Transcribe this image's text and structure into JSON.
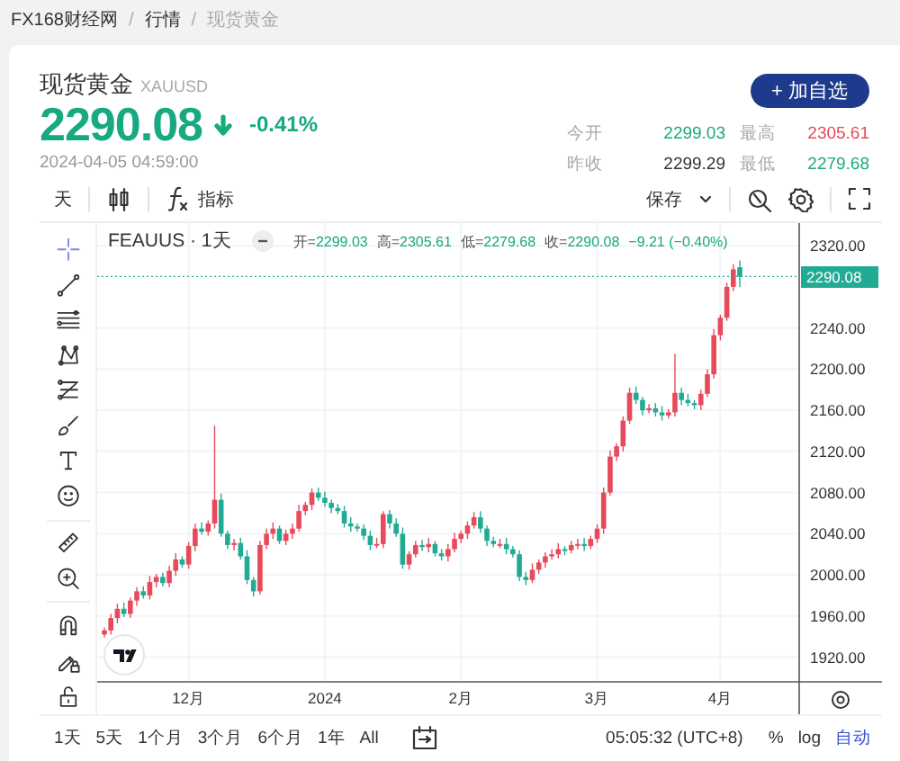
{
  "breadcrumb": {
    "separator": "/",
    "items": [
      {
        "label": "FX168财经网",
        "current": false
      },
      {
        "label": "行情",
        "current": false
      },
      {
        "label": "现货黄金",
        "current": true
      }
    ]
  },
  "quote": {
    "name": "现货黄金",
    "symbol": "XAUUSD",
    "price": "2290.08",
    "price_down": true,
    "change": "-0.41%",
    "time": "2024-04-05 04:59:00",
    "watch_button": "+ 加自选"
  },
  "stats": [
    {
      "label": "今开",
      "value": "2299.03",
      "color": "#1aa97f"
    },
    {
      "label": "最高",
      "value": "2305.61",
      "color": "#e8495b"
    },
    {
      "label": "昨收",
      "value": "2299.29",
      "color": "#333333"
    },
    {
      "label": "最低",
      "value": "2279.68",
      "color": "#1aa97f"
    }
  ],
  "toolbar": {
    "interval": "天",
    "indicators_label": "指标",
    "save_label": "保存"
  },
  "chart": {
    "legend": [
      {
        "label": "开=",
        "value": "2299.03"
      },
      {
        "label": "高=",
        "value": "2305.61"
      },
      {
        "label": "低=",
        "value": "2279.68"
      },
      {
        "label": "收=",
        "value": "2290.08"
      }
    ],
    "change": "−9.21 (−0.40%)",
    "last_price": "2290.08",
    "chart_data": {
      "type": "candlestick",
      "title": "FEAUUS · 1天",
      "grid": true,
      "ylim": [
        1896,
        2342
      ],
      "ref_lines": [
        {
          "axis": "y",
          "value": 2290.08
        }
      ],
      "categories": [
        null,
        null,
        null,
        null,
        null,
        null,
        null,
        null,
        null,
        null,
        null,
        null,
        null,
        "12月",
        null,
        null,
        null,
        null,
        null,
        null,
        null,
        null,
        null,
        null,
        null,
        null,
        null,
        null,
        null,
        null,
        null,
        null,
        null,
        null,
        "2024",
        null,
        null,
        null,
        null,
        null,
        null,
        null,
        null,
        null,
        null,
        null,
        null,
        null,
        null,
        null,
        null,
        null,
        null,
        null,
        null,
        "2月",
        null,
        null,
        null,
        null,
        null,
        null,
        null,
        null,
        null,
        null,
        null,
        null,
        null,
        null,
        null,
        null,
        null,
        null,
        null,
        null,
        "3月",
        null,
        null,
        null,
        null,
        null,
        null,
        null,
        null,
        null,
        null,
        null,
        null,
        null,
        null,
        null,
        null,
        null,
        null,
        "4月",
        null,
        null,
        null
      ],
      "yticks": [
        {
          "value": 1920,
          "label": "1920.00"
        },
        {
          "value": 1960,
          "label": "1960.00"
        },
        {
          "value": 2000,
          "label": "2000.00"
        },
        {
          "value": 2040,
          "label": "2040.00"
        },
        {
          "value": 2080,
          "label": "2080.00"
        },
        {
          "value": 2120,
          "label": "2120.00"
        },
        {
          "value": 2160,
          "label": "2160.00"
        },
        {
          "value": 2200,
          "label": "2200.00"
        },
        {
          "value": 2240,
          "label": "2240.00"
        },
        {
          "value": 2320,
          "label": "2320.00"
        }
      ],
      "ohlc": [
        [
          1942,
          1949,
          1939,
          1946
        ],
        [
          1946,
          1962,
          1942,
          1958
        ],
        [
          1958,
          1972,
          1953,
          1967
        ],
        [
          1967,
          1973,
          1959,
          1962
        ],
        [
          1962,
          1978,
          1958,
          1975
        ],
        [
          1975,
          1988,
          1970,
          1984
        ],
        [
          1984,
          1989,
          1977,
          1980
        ],
        [
          1980,
          1999,
          1976,
          1993
        ],
        [
          1993,
          2001,
          1988,
          1998
        ],
        [
          1998,
          2002,
          1989,
          1992
        ],
        [
          1992,
          2009,
          1988,
          2004
        ],
        [
          2004,
          2021,
          1999,
          2015
        ],
        [
          2015,
          2018,
          2007,
          2010
        ],
        [
          2010,
          2032,
          2006,
          2028
        ],
        [
          2028,
          2050,
          2023,
          2045
        ],
        [
          2045,
          2051,
          2039,
          2042
        ],
        [
          2042,
          2053,
          2038,
          2050
        ],
        [
          2050,
          2145,
          2045,
          2073
        ],
        [
          2073,
          2079,
          2037,
          2040
        ],
        [
          2040,
          2043,
          2025,
          2029
        ],
        [
          2029,
          2035,
          2024,
          2031
        ],
        [
          2031,
          2036,
          2015,
          2018
        ],
        [
          2018,
          2024,
          1991,
          1995
        ],
        [
          1995,
          1998,
          1979,
          1984
        ],
        [
          1984,
          2033,
          1981,
          2029
        ],
        [
          2029,
          2045,
          2025,
          2040
        ],
        [
          2040,
          2051,
          2035,
          2045
        ],
        [
          2045,
          2048,
          2030,
          2033
        ],
        [
          2033,
          2044,
          2029,
          2040
        ],
        [
          2040,
          2050,
          2035,
          2045
        ],
        [
          2045,
          2068,
          2042,
          2062
        ],
        [
          2062,
          2071,
          2058,
          2068
        ],
        [
          2068,
          2084,
          2063,
          2080
        ],
        [
          2080,
          2085,
          2072,
          2075
        ],
        [
          2075,
          2081,
          2066,
          2070
        ],
        [
          2070,
          2073,
          2060,
          2065
        ],
        [
          2065,
          2069,
          2059,
          2062
        ],
        [
          2062,
          2067,
          2046,
          2050
        ],
        [
          2050,
          2056,
          2042,
          2047
        ],
        [
          2047,
          2050,
          2042,
          2045
        ],
        [
          2045,
          2049,
          2034,
          2038
        ],
        [
          2038,
          2043,
          2024,
          2029
        ],
        [
          2029,
          2036,
          2026,
          2030
        ],
        [
          2030,
          2062,
          2026,
          2059
        ],
        [
          2059,
          2063,
          2045,
          2050
        ],
        [
          2050,
          2055,
          2037,
          2040
        ],
        [
          2040,
          2046,
          2006,
          2010
        ],
        [
          2010,
          2023,
          2005,
          2020
        ],
        [
          2020,
          2033,
          2017,
          2029
        ],
        [
          2029,
          2034,
          2023,
          2027
        ],
        [
          2027,
          2036,
          2022,
          2030
        ],
        [
          2030,
          2033,
          2018,
          2021
        ],
        [
          2021,
          2025,
          2014,
          2018
        ],
        [
          2018,
          2030,
          2013,
          2025
        ],
        [
          2025,
          2041,
          2022,
          2035
        ],
        [
          2035,
          2043,
          2031,
          2040
        ],
        [
          2040,
          2052,
          2035,
          2048
        ],
        [
          2048,
          2061,
          2045,
          2056
        ],
        [
          2056,
          2062,
          2041,
          2045
        ],
        [
          2045,
          2048,
          2028,
          2033
        ],
        [
          2033,
          2037,
          2027,
          2030
        ],
        [
          2030,
          2035,
          2026,
          2030
        ],
        [
          2030,
          2036,
          2020,
          2025
        ],
        [
          2025,
          2028,
          2017,
          2020
        ],
        [
          2020,
          2024,
          1994,
          1998
        ],
        [
          1998,
          2003,
          1990,
          1995
        ],
        [
          1995,
          2011,
          1992,
          2005
        ],
        [
          2005,
          2015,
          2001,
          2012
        ],
        [
          2012,
          2022,
          2007,
          2018
        ],
        [
          2018,
          2025,
          2015,
          2020
        ],
        [
          2020,
          2031,
          2016,
          2025
        ],
        [
          2025,
          2028,
          2019,
          2024
        ],
        [
          2024,
          2033,
          2021,
          2029
        ],
        [
          2029,
          2035,
          2025,
          2030
        ],
        [
          2030,
          2036,
          2023,
          2028
        ],
        [
          2028,
          2038,
          2025,
          2035
        ],
        [
          2035,
          2049,
          2031,
          2045
        ],
        [
          2045,
          2085,
          2040,
          2080
        ],
        [
          2080,
          2121,
          2077,
          2115
        ],
        [
          2115,
          2128,
          2111,
          2125
        ],
        [
          2125,
          2154,
          2120,
          2150
        ],
        [
          2150,
          2182,
          2147,
          2177
        ],
        [
          2177,
          2183,
          2166,
          2170
        ],
        [
          2170,
          2173,
          2155,
          2160
        ],
        [
          2160,
          2166,
          2157,
          2162
        ],
        [
          2162,
          2167,
          2154,
          2158
        ],
        [
          2158,
          2164,
          2150,
          2155
        ],
        [
          2155,
          2161,
          2152,
          2158
        ],
        [
          2158,
          2215,
          2154,
          2177
        ],
        [
          2177,
          2182,
          2165,
          2170
        ],
        [
          2170,
          2176,
          2164,
          2167
        ],
        [
          2167,
          2170,
          2161,
          2165
        ],
        [
          2165,
          2180,
          2160,
          2176
        ],
        [
          2176,
          2200,
          2173,
          2195
        ],
        [
          2195,
          2239,
          2191,
          2233
        ],
        [
          2233,
          2253,
          2228,
          2250
        ],
        [
          2250,
          2284,
          2247,
          2280
        ],
        [
          2280,
          2302,
          2276,
          2297
        ],
        [
          2299.03,
          2305.61,
          2279.68,
          2290.08
        ]
      ]
    }
  },
  "ranges": [
    {
      "label": "1天"
    },
    {
      "label": "5天"
    },
    {
      "label": "1个月"
    },
    {
      "label": "3个月"
    },
    {
      "label": "6个月"
    },
    {
      "label": "1年"
    },
    {
      "label": "All"
    }
  ],
  "clock": "05:05:32 (UTC+8)",
  "scale_buttons": [
    {
      "label": "%",
      "selected": false
    },
    {
      "label": "log",
      "selected": false
    },
    {
      "label": "自动",
      "selected": true
    }
  ]
}
